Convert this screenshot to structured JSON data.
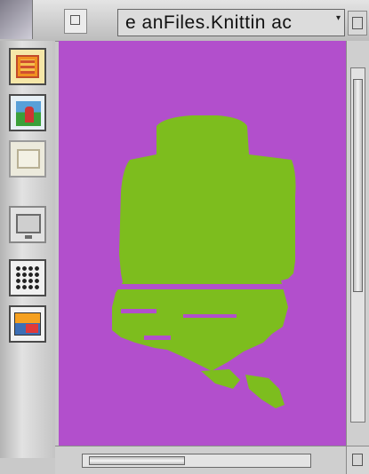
{
  "window": {
    "title": "e  anFiles.Knittin  ac",
    "title_menu_arrow": "▾"
  },
  "toolbar": {
    "tools": [
      {
        "name": "garment-tool",
        "icon": "sweater-icon"
      },
      {
        "name": "figure-tool",
        "icon": "figure-icon"
      },
      {
        "name": "scene-tool",
        "icon": "scene-icon"
      },
      {
        "name": "monitor-tool",
        "icon": "monitor-icon"
      },
      {
        "name": "grid-tool",
        "icon": "dot-grid-icon"
      },
      {
        "name": "palette-tool",
        "icon": "palette-icon"
      }
    ]
  },
  "canvas": {
    "background_color": "#b24fcc",
    "pattern_color": "#7dbd1e"
  },
  "scrollbars": {
    "vertical_position": 0.05,
    "horizontal_position": 0.02
  }
}
